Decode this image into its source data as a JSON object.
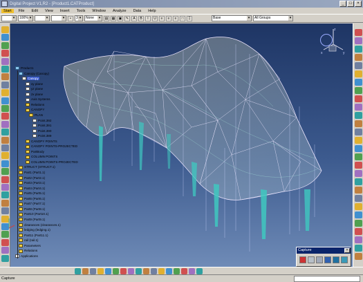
{
  "window": {
    "title": "Digital Project V1,R2 - [Product1.CATProduct]",
    "buttons": [
      "_",
      "□",
      "×"
    ]
  },
  "menu": {
    "items": [
      "Start",
      "File",
      "Edit",
      "View",
      "Insert",
      "Tools",
      "Window",
      "Analyze",
      "Data",
      "Help"
    ]
  },
  "toolbar": {
    "zoom_value": "100%",
    "layer_number": "3",
    "style_value": "None",
    "filter_value": "Base",
    "groups_value": "All Groups"
  },
  "tree": {
    "nodes": [
      {
        "label": "Product1",
        "indent": 0,
        "icon": "blue"
      },
      {
        "label": "Canopy (Canopy)",
        "indent": 1,
        "icon": "blue"
      },
      {
        "label": "Canopy",
        "indent": 2,
        "icon": "white",
        "highlight": true
      },
      {
        "label": "xy plane",
        "indent": 3,
        "icon": "white"
      },
      {
        "label": "yz plane",
        "indent": 3,
        "icon": "white"
      },
      {
        "label": "zx plane",
        "indent": 3,
        "icon": "white"
      },
      {
        "label": "Axis Systems",
        "indent": 3,
        "icon": "white"
      },
      {
        "label": "Relations",
        "indent": 3,
        "icon": "yellow"
      },
      {
        "label": "CANOPY",
        "indent": 3,
        "icon": "yellow"
      },
      {
        "label": "PLAN",
        "indent": 4,
        "icon": "yellow"
      },
      {
        "label": "Point.392",
        "indent": 5,
        "icon": "white"
      },
      {
        "label": "Point.391",
        "indent": 5,
        "icon": "white"
      },
      {
        "label": "Point.390",
        "indent": 5,
        "icon": "white"
      },
      {
        "label": "Point.389",
        "indent": 5,
        "icon": "white"
      },
      {
        "label": "CANOPY POINTS",
        "indent": 3,
        "icon": "yellow"
      },
      {
        "label": "CANOPY POINTS-PROJECTED",
        "indent": 3,
        "icon": "yellow"
      },
      {
        "label": "PartBody",
        "indent": 3,
        "icon": "yellow"
      },
      {
        "label": "COLUMN POINTS",
        "indent": 3,
        "icon": "yellow"
      },
      {
        "label": "COLUMN POINTS-PROJECTED",
        "indent": 3,
        "icon": "yellow"
      },
      {
        "label": "STRUCT (STRUCT.1)",
        "indent": 1,
        "icon": "yellow"
      },
      {
        "label": "Part1 (Part1.1)",
        "indent": 1,
        "icon": "yellow"
      },
      {
        "label": "Part2 (Part2.1)",
        "indent": 1,
        "icon": "yellow"
      },
      {
        "label": "Part3 (Part3.1)",
        "indent": 1,
        "icon": "yellow"
      },
      {
        "label": "Part4 (Part4.1)",
        "indent": 1,
        "icon": "yellow"
      },
      {
        "label": "Part5 (Part5.1)",
        "indent": 1,
        "icon": "yellow"
      },
      {
        "label": "Part6 (Part6.1)",
        "indent": 1,
        "icon": "yellow"
      },
      {
        "label": "Part7 (Part7.1)",
        "indent": 1,
        "icon": "yellow"
      },
      {
        "label": "Part8 (Part8.1)",
        "indent": 1,
        "icon": "yellow"
      },
      {
        "label": "Part10 (Part10.1)",
        "indent": 1,
        "icon": "yellow"
      },
      {
        "label": "Part9 (Part9.1)",
        "indent": 1,
        "icon": "yellow"
      },
      {
        "label": "clearances (clearances.1)",
        "indent": 1,
        "icon": "yellow"
      },
      {
        "label": "ledging (ledging.1)",
        "indent": 1,
        "icon": "yellow"
      },
      {
        "label": "Part11 (Part11.1)",
        "indent": 1,
        "icon": "yellow"
      },
      {
        "label": "rail (rail.1)",
        "indent": 1,
        "icon": "yellow"
      },
      {
        "label": "Parameters",
        "indent": 1,
        "icon": "yellow"
      },
      {
        "label": "Relations",
        "indent": 1,
        "icon": "yellow"
      },
      {
        "label": "Applications",
        "indent": 0,
        "icon": "white"
      }
    ]
  },
  "compass": {
    "x_label": "x",
    "y_label": "y",
    "z_label": "z"
  },
  "capture": {
    "title": "Capture",
    "close_label": "×"
  },
  "status": {
    "text": "Capture"
  },
  "colors": {
    "viewport_top": "#1e3564",
    "viewport_bottom": "#6f8bb7",
    "mesh_edge": "#e8e4f0",
    "column_color": "#4fd0c8",
    "canopy_fill": "#e8d890",
    "selection": "#3355cc"
  },
  "icons": {
    "left_toolbar": [
      "select-icon",
      "sketch-icon",
      "hand-icon",
      "plane-icon",
      "point-icon",
      "line-icon",
      "curve-icon",
      "axis-icon",
      "spline-icon",
      "surface-icon",
      "extrude-icon",
      "revolve-icon",
      "sweep-icon",
      "fill-icon",
      "join-icon",
      "split-icon",
      "trim-icon",
      "boundary-icon",
      "extract-icon",
      "measure-icon",
      "parts-icon",
      "grid-icon",
      "snap-icon",
      "bar-icon",
      "chain-icon",
      "filter-icon",
      "view-icon",
      "settings-icon",
      "lock-icon",
      "info-icon"
    ],
    "right_toolbar": [
      "cursor-icon",
      "line-icon",
      "arc-icon",
      "rect-icon",
      "circle-icon",
      "spline-icon",
      "sketch-icon",
      "plane-icon",
      "point-icon",
      "surface-icon",
      "sweep-icon",
      "fill-icon",
      "loft-icon",
      "offset-icon",
      "check-icon",
      "blend-icon",
      "join-icon",
      "heal-icon",
      "trim-icon",
      "split-icon",
      "boundary-icon",
      "analysis-icon",
      "render-icon",
      "texture-icon",
      "light-icon",
      "camera-icon",
      "envir-icon",
      "shadow-icon"
    ],
    "bottom_toolbar": [
      "fly-icon",
      "walk-icon",
      "pan-icon",
      "rotate-icon",
      "zoom-in-icon",
      "zoom-out-icon",
      "normal-view-icon",
      "multi-view-icon",
      "iso-view-icon",
      "shading-icon",
      "hide-show-icon",
      "swap-icon",
      "material-icon",
      "eye-icon",
      "layer-icon",
      "lock-icon",
      "wireframe-icon"
    ]
  }
}
